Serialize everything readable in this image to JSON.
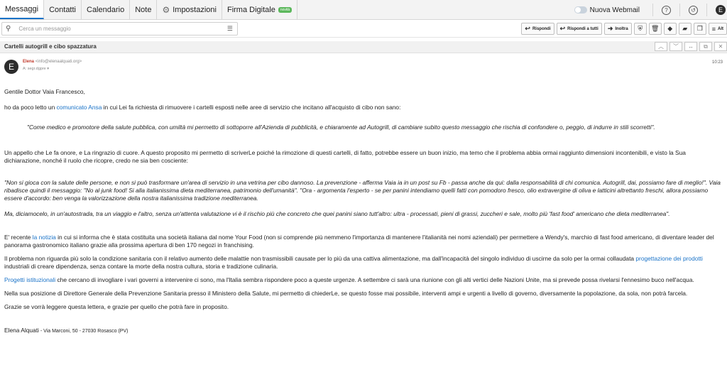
{
  "tabs": [
    {
      "label": "Messaggi"
    },
    {
      "label": "Contatti"
    },
    {
      "label": "Calendario"
    },
    {
      "label": "Note"
    },
    {
      "label": "Impostazioni"
    },
    {
      "label": "Firma Digitale",
      "badge": "novità"
    }
  ],
  "topright": {
    "nuova_webmail": "Nuova Webmail",
    "user_initial": "E"
  },
  "search": {
    "placeholder": "Cerca un messaggio"
  },
  "actions": {
    "rispondi": "Rispondi",
    "rispondi_tutti": "Rispondi a tutti",
    "inoltra": "Inoltra",
    "altro": "Alt"
  },
  "message": {
    "subject": "Cartelli autogrill e cibo spazzatura",
    "avatar": "E",
    "from_name": "Elena",
    "from_email": "<info@elenaalquati.org>",
    "to": "A: segr.dgpre ▾",
    "time": "10:23",
    "greeting": "Gentile Dottor Vaia Francesco,",
    "p1_a": "ho da poco letto un ",
    "p1_link": "comunicato Ansa",
    "p1_b": " in cui Lei fa richiesta di rimuovere i cartelli esposti nelle aree di servizio che incitano all'acquisto di cibo non sano:",
    "quote1": "\"Come medico e promotore della salute pubblica, con umiltà mi permetto di sottoporre all'Azienda di pubblicità, e chiaramente ad Autogrill, di cambiare subito questo messaggio che rischia di confondere o, peggio, di indurre in stili scorretti\".",
    "p2": "Un appello che Le fa onore, e La ringrazio  di cuore. A questo proposito mi permetto di scriverLe poiché la rimozione di questi cartelli, di fatto, potrebbe essere un buon inizio, ma temo che il problema abbia ormai raggiunto dimensioni incontenibili, e visto la Sua dichiarazione, nonché il ruolo che ricopre, credo ne sia ben cosciente:",
    "quote2": "\"Non si gioca con la salute delle persone, e non si può trasformare un'area di servizio in una vetrina per cibo dannoso. La prevenzione - afferma Vaia ia in un post su Fb - passa anche da qui: dalla responsabilità di chi comunica. Autogrill, dai, possiamo fare di meglio!\". Vaia ribadisce quindi il messaggio: \"No al junk food! Si alla italianissima dieta mediterranea, patrimonio dell'umanità\". \"Ora - argomenta l'esperto - se per panini intendiamo quelli fatti con pomodoro fresco, olio extravergine di oliva e latticini altrettanto freschi, allora possiamo essere d'accordo: ben venga la valorizzazione della nostra italianissima tradizione mediterranea.",
    "quote3": "Ma, diciamocelo, in un'autostrada, tra un viaggio e l'altro, senza un'attenta valutazione vi è il rischio più che concreto che quei panini siano tutt'altro: ultra - processati, pieni di grassi, zuccheri e sale, molto più 'fast food' americano che dieta mediterranea\".",
    "p3_a": "E' recente ",
    "p3_link": "la notizia",
    "p3_b": " in cui si informa che è stata costituita una società italiana dal nome Your Food (non si comprende più nemmeno l'importanza di mantenere l'italianità nei nomi aziendali) per permettere a Wendy's, marchio di fast food americano, di diventare leader del panorama gastronomico italiano grazie alla prossima apertura di ben 170 negozi in franchising.",
    "p4_a": "Il problema non riguarda più solo la condizione sanitaria con il relativo aumento delle malattie non trasmissibili  causate per lo più da una cattiva alimentazione, ma dall'incapacità del singolo individuo di uscirne da solo per la ormai collaudata ",
    "p4_link": "progettazione dei prodotti",
    "p4_b": " industriali di creare dipendenza, senza contare la morte della nostra cultura, storia e tradizione culinaria.",
    "p5_link": "Progetti istituzionali",
    "p5_b": " che cercano di invogliare i vari governi a intervenire ci sono, ma l'Italia sembra rispondere poco a queste urgenze. A settembre ci sarà una riunione con gli alti vertici delle Nazioni Unite, ma si prevede possa rivelarsi l'ennesimo buco nell'acqua.",
    "p6": "Nella sua posizione di Direttore Generale della Prevenzione Sanitaria presso il Ministero della Salute, mi permetto di chiederLe, se questo fosse mai possibile, interventi ampi e urgenti a livello di governo, diversamente la popolazione, da sola, non potrà farcela.",
    "p7": "Grazie se vorrà leggere questa lettera, e grazie per quello che potrà fare in proposito.",
    "sig_name": "Elena Alquati",
    "sig_addr": " - Via Marconi, 50 - 27030 Rosasco (PV)"
  }
}
